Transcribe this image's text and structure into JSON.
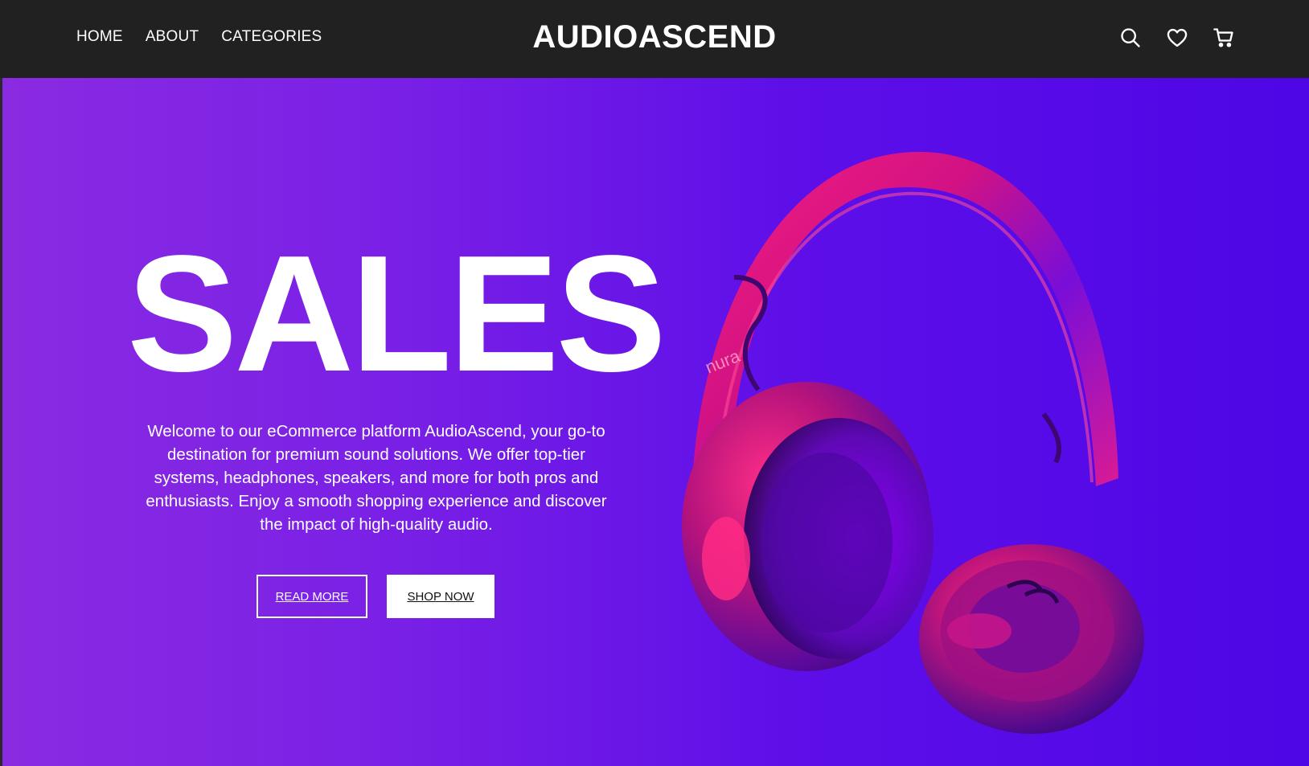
{
  "header": {
    "nav": [
      "HOME",
      "ABOUT",
      "CATEGORIES"
    ],
    "brand": "AUDIOASCEND",
    "icons": [
      "search-icon",
      "heart-icon",
      "cart-icon"
    ]
  },
  "hero": {
    "title": "SALES",
    "description": "Welcome to our eCommerce platform AudioAscend, your go-to destination for premium sound solutions. We offer top-tier systems, headphones, speakers, and more for both pros and enthusiasts. Enjoy a smooth shopping experience and discover the impact of high-quality audio.",
    "buttons": {
      "read_more": "READ MORE",
      "shop_now": "SHOP NOW"
    },
    "product_brand_text": "nura"
  },
  "colors": {
    "header_bg": "#212121",
    "hero_gradient_start": "#8a2be2",
    "hero_gradient_end": "#4e06e6",
    "headphone_pink": "#ff1f7a",
    "headphone_purple": "#6a00d8"
  }
}
